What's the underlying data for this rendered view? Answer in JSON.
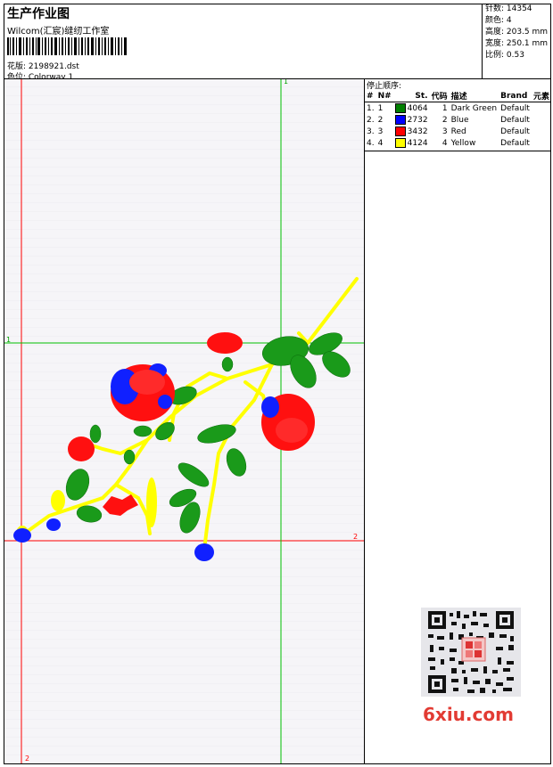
{
  "header": {
    "title": "生产作业图",
    "subtitle": "Wilcom(汇宸)缝纫工作室",
    "design_label": "花版: 2198921.dst",
    "colorway_label": "色位:  Colorway 1"
  },
  "stats": {
    "stitches": "针数: 14354",
    "colors": "颜色: 4",
    "height": "高度: 203.5 mm",
    "width": "宽度: 250.1 mm",
    "scale": "比例: 0.53"
  },
  "stops": {
    "title": "停止顺序:",
    "headers": [
      "#",
      "N#",
      "St.",
      "代码",
      "描述",
      "Brand",
      "元素"
    ],
    "rows": [
      {
        "idx": "1.",
        "n": "1",
        "st": "4064",
        "code": "1",
        "desc": "Dark Green",
        "brand": "Default",
        "color": "#008000"
      },
      {
        "idx": "2.",
        "n": "2",
        "st": "2732",
        "code": "2",
        "desc": "Blue",
        "brand": "Default",
        "color": "#0000ff"
      },
      {
        "idx": "3.",
        "n": "3",
        "st": "3432",
        "code": "3",
        "desc": "Red",
        "brand": "Default",
        "color": "#ff0000"
      },
      {
        "idx": "4.",
        "n": "4",
        "st": "4124",
        "code": "4",
        "desc": "Yellow",
        "brand": "Default",
        "color": "#ffff00"
      }
    ]
  },
  "markers": {
    "one": "1",
    "two": "2"
  },
  "watermark": "6xiu.com",
  "colors": {
    "green_line": "#00c000",
    "red_line": "#ff0000"
  }
}
